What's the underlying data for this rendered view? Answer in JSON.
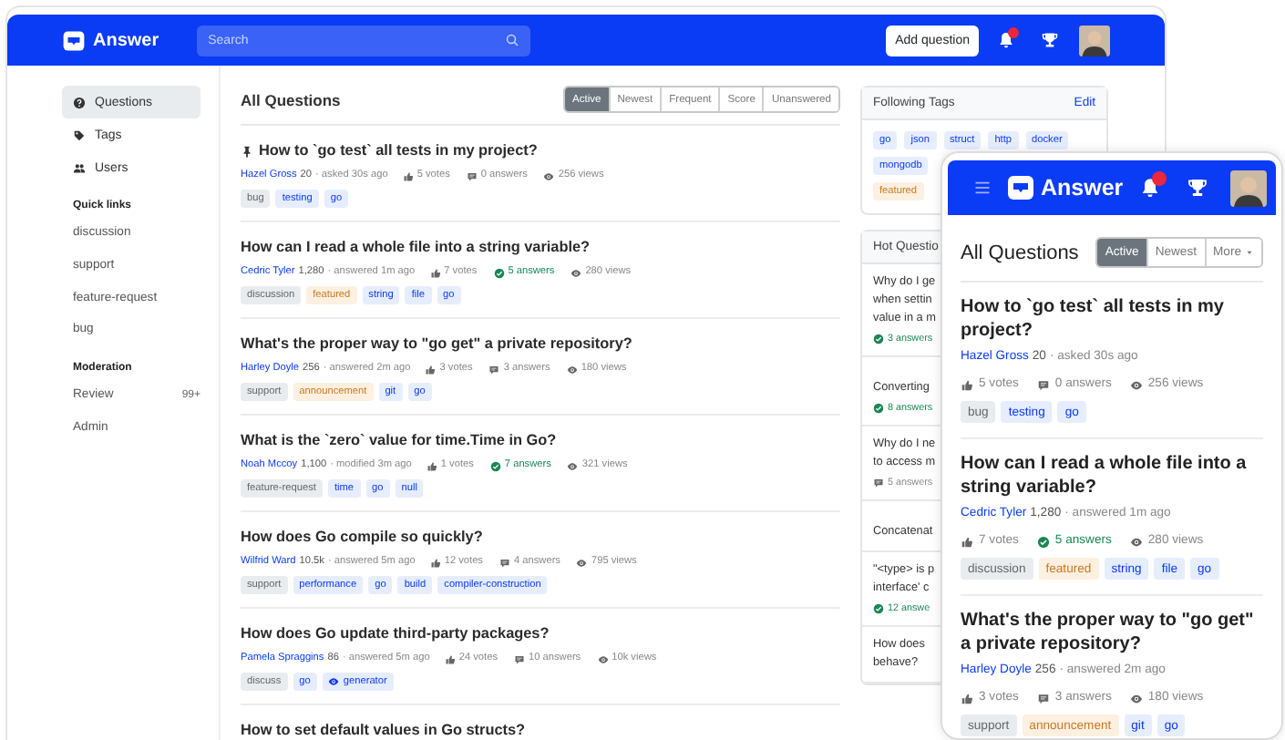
{
  "desktop": {
    "header": {
      "logo": "Answer",
      "search": {
        "placeholder": "Search"
      },
      "add_button": "Add question",
      "has_notification": true
    },
    "sidebar": {
      "nav": [
        {
          "label": "Questions",
          "selected": true
        },
        {
          "label": "Tags",
          "selected": false
        },
        {
          "label": "Users",
          "selected": false
        }
      ],
      "sections": [
        {
          "title": "Quick links",
          "links": [
            {
              "label": "discussion"
            },
            {
              "label": "support"
            },
            {
              "label": "feature-request"
            },
            {
              "label": "bug"
            }
          ]
        },
        {
          "title": "Moderation",
          "links": [
            {
              "label": "Review",
              "badge": "99+"
            },
            {
              "label": "Admin"
            }
          ]
        }
      ]
    },
    "main": {
      "title": "All Questions",
      "sort_tabs": [
        {
          "label": "Active",
          "selected": true
        },
        {
          "label": "Newest",
          "selected": false
        },
        {
          "label": "Frequent",
          "selected": false
        },
        {
          "label": "Score",
          "selected": false
        },
        {
          "label": "Unanswered",
          "selected": false
        }
      ],
      "questions": [
        {
          "title": "How to `go test` all tests in my project?",
          "pinned": true,
          "author": "Hazel Gross",
          "reputation": "20",
          "action": "· asked 30s ago",
          "votes": "5 votes",
          "answers": "0 answers",
          "accepted": false,
          "views": "256 views",
          "tags": [
            {
              "label": "bug",
              "kind": "reserved"
            },
            {
              "label": "testing",
              "kind": "tag"
            },
            {
              "label": "go",
              "kind": "tag"
            }
          ]
        },
        {
          "title": "How can I read a whole file into a string variable?",
          "pinned": false,
          "author": "Cedric Tyler",
          "reputation": "1,280",
          "action": "· answered 1m ago",
          "votes": "7 votes",
          "answers": "5 answers",
          "accepted": true,
          "views": "280 views",
          "tags": [
            {
              "label": "discussion",
              "kind": "reserved"
            },
            {
              "label": "featured",
              "kind": "recommend"
            },
            {
              "label": "string",
              "kind": "tag"
            },
            {
              "label": "file",
              "kind": "tag"
            },
            {
              "label": "go",
              "kind": "tag"
            }
          ]
        },
        {
          "title": "What's the proper way to \"go get\" a private repository?",
          "pinned": false,
          "author": "Harley Doyle",
          "reputation": "256",
          "action": "· answered 2m ago",
          "votes": "3 votes",
          "answers": "3 answers",
          "accepted": false,
          "views": "180 views",
          "tags": [
            {
              "label": "support",
              "kind": "reserved"
            },
            {
              "label": "announcement",
              "kind": "recommend"
            },
            {
              "label": "git",
              "kind": "tag"
            },
            {
              "label": "go",
              "kind": "tag"
            }
          ]
        },
        {
          "title": "What is the `zero` value for time.Time in Go?",
          "pinned": false,
          "author": "Noah Mccoy",
          "reputation": "1,100",
          "action": "· modified 3m ago",
          "votes": "1 votes",
          "answers": "7 answers",
          "accepted": true,
          "views": "321 views",
          "tags": [
            {
              "label": "feature-request",
              "kind": "reserved"
            },
            {
              "label": "time",
              "kind": "tag"
            },
            {
              "label": "go",
              "kind": "tag"
            },
            {
              "label": "null",
              "kind": "tag"
            }
          ]
        },
        {
          "title": "How does Go compile so quickly?",
          "pinned": false,
          "author": "Wilfrid Ward",
          "reputation": "10.5k",
          "action": "· answered 5m ago",
          "votes": "12 votes",
          "answers": "4 answers",
          "accepted": false,
          "views": "795 views",
          "tags": [
            {
              "label": "support",
              "kind": "reserved"
            },
            {
              "label": "performance",
              "kind": "tag"
            },
            {
              "label": "go",
              "kind": "tag"
            },
            {
              "label": "build",
              "kind": "tag"
            },
            {
              "label": "compiler-construction",
              "kind": "tag"
            }
          ]
        },
        {
          "title": "How does Go update third-party packages?",
          "pinned": false,
          "author": "Pamela Spraggins",
          "reputation": "86",
          "action": "· answered 5m ago",
          "votes": "24 votes",
          "answers": "10 answers",
          "accepted": false,
          "views": "10k views",
          "tags": [
            {
              "label": "discuss",
              "kind": "reserved"
            },
            {
              "label": "go",
              "kind": "tag"
            },
            {
              "label": "generator",
              "kind": "watched"
            }
          ]
        },
        {
          "title": "How to set default values in Go structs?",
          "pinned": false
        }
      ]
    },
    "following_tags": {
      "title": "Following Tags",
      "edit": "Edit",
      "rows": [
        [
          {
            "label": "go",
            "kind": "tag"
          },
          {
            "label": "json",
            "kind": "tag"
          },
          {
            "label": "struct",
            "kind": "tag"
          },
          {
            "label": "http",
            "kind": "tag"
          },
          {
            "label": "docker",
            "kind": "tag"
          }
        ],
        [
          {
            "label": "mongodb",
            "kind": "tag"
          }
        ],
        [
          {
            "label": "featured",
            "kind": "recommend"
          }
        ]
      ]
    },
    "hot_questions": {
      "title": "Hot Questio",
      "items": [
        {
          "lines": [
            "Why do I ge",
            "when settin",
            "value in a m"
          ],
          "answers": "3 answers",
          "accepted": true
        },
        {
          "lines": [
            "Converting"
          ],
          "answers": "8 answers",
          "accepted": true
        },
        {
          "lines": [
            "Why do I ne",
            "to access m"
          ],
          "answers": "5 answers",
          "accepted": false
        },
        {
          "lines": [
            "Concatenat"
          ]
        },
        {
          "lines": [
            "\"<type> is p",
            "interface' c"
          ],
          "answers": "12 answe",
          "accepted": true
        },
        {
          "lines": [
            "How does",
            "behave?"
          ]
        }
      ]
    }
  },
  "mobile": {
    "header": {
      "logo": "Answer",
      "has_notification": true
    },
    "main": {
      "title": "All Questions",
      "sort_tabs": [
        {
          "label": "Active",
          "kind": "tab",
          "selected": true
        },
        {
          "label": "Newest",
          "kind": "tab",
          "selected": false
        },
        {
          "label": "More",
          "kind": "dropdown",
          "selected": false
        }
      ],
      "questions": [
        {
          "title": "How to `go test` all tests in my project?",
          "author": "Hazel Gross",
          "reputation": "20",
          "action": "· asked 30s ago",
          "votes": "5 votes",
          "answers": "0 answers",
          "accepted": false,
          "views": "256 views",
          "tags": [
            {
              "label": "bug",
              "kind": "reserved"
            },
            {
              "label": "testing",
              "kind": "tag"
            },
            {
              "label": "go",
              "kind": "tag"
            }
          ]
        },
        {
          "title": "How can I read a whole file into a string variable?",
          "author": "Cedric Tyler",
          "reputation": "1,280",
          "action": "· answered 1m ago",
          "votes": "7 votes",
          "answers": "5 answers",
          "accepted": true,
          "views": "280 views",
          "tags": [
            {
              "label": "discussion",
              "kind": "reserved"
            },
            {
              "label": "featured",
              "kind": "recommend"
            },
            {
              "label": "string",
              "kind": "tag"
            },
            {
              "label": "file",
              "kind": "tag"
            },
            {
              "label": "go",
              "kind": "tag"
            }
          ]
        },
        {
          "title": "What's the proper way to \"go get\" a private repository?",
          "author": "Harley Doyle",
          "reputation": "256",
          "action": "· answered 2m ago",
          "votes": "3 votes",
          "answers": "3 answers",
          "accepted": false,
          "views": "180 views",
          "tags": [
            {
              "label": "support",
              "kind": "reserved"
            },
            {
              "label": "announcement",
              "kind": "recommend"
            },
            {
              "label": "git",
              "kind": "tag"
            },
            {
              "label": "go",
              "kind": "tag"
            }
          ]
        }
      ]
    }
  }
}
